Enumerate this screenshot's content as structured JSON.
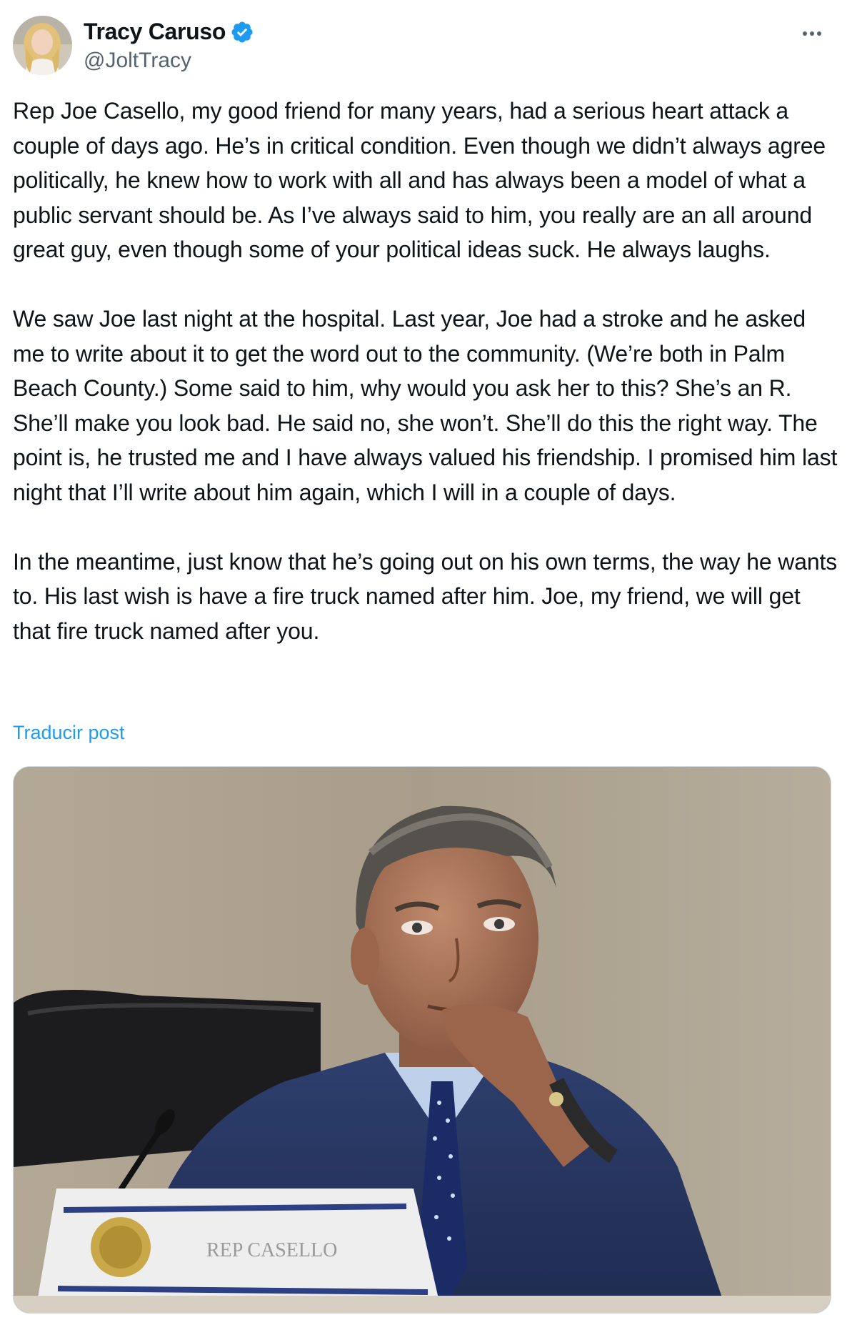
{
  "author": {
    "display_name": "Tracy Caruso",
    "handle": "@JoltTracy",
    "verified": true,
    "verified_color": "#1d9bf0"
  },
  "actions": {
    "more_icon": "more-horizontal-icon"
  },
  "tweet": {
    "paragraphs": [
      "Rep Joe Casello, my good friend for many years, had a serious heart attack a couple of days ago. He’s in critical condition. Even though we didn’t always agree politically, he knew how to work with all and has always been a model of what a public servant should be. As I’ve always said to him, you really are an all around great guy, even though some of your political ideas suck. He always laughs.",
      "We saw Joe last night at the hospital. Last year, Joe  had a stroke and he asked me to write about it to get the word out to the community. (We’re both in Palm Beach County.) Some said to him, why would you ask her to this? She’s an R. She’ll make you look bad. He said no, she won’t. She’ll do this the right way. The point is, he trusted me and I have always valued his friendship. I promised him last night that I’ll write about him again, which I will in a couple of days.",
      "In the meantime, just know that he’s going out on his own terms, the way he wants to. His last wish is have a fire truck named after him. Joe, my friend, we will get that fire truck named after you."
    ],
    "translate_label": "Traducir post",
    "link_color": "#1d9bf0"
  },
  "media": {
    "nameplate_text": "REP CASELLO"
  }
}
